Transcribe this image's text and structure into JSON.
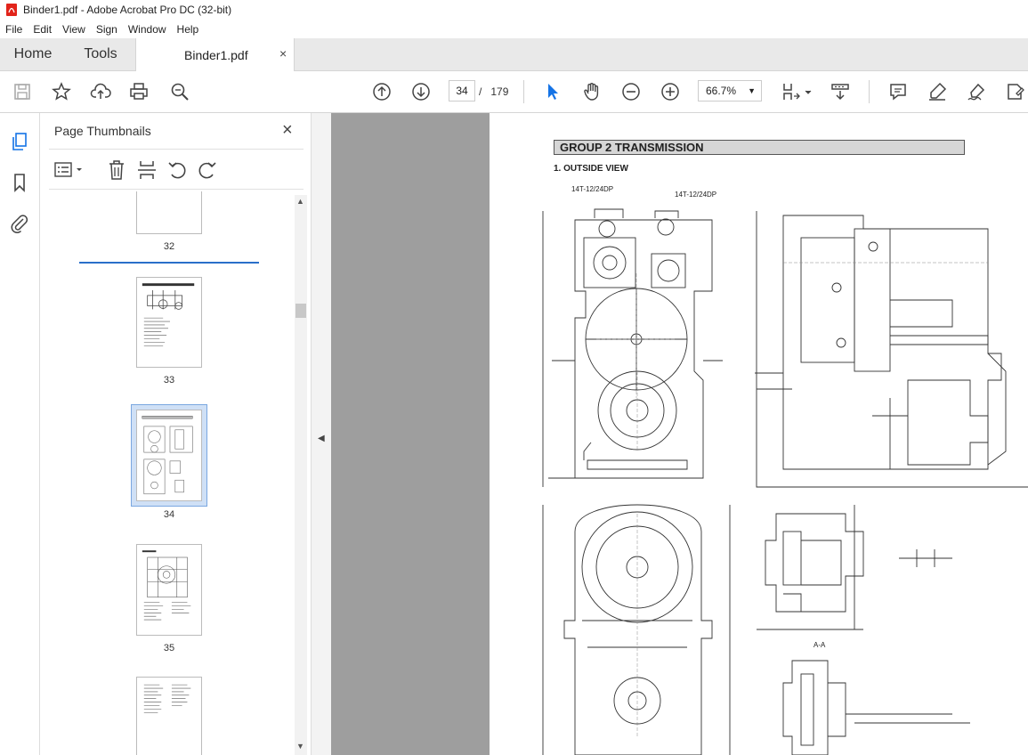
{
  "window": {
    "title": "Binder1.pdf - Adobe Acrobat Pro DC (32-bit)"
  },
  "menu": [
    "File",
    "Edit",
    "View",
    "Sign",
    "Window",
    "Help"
  ],
  "tabs": {
    "home": "Home",
    "tools": "Tools",
    "document": "Binder1.pdf",
    "close": "×"
  },
  "toolbar": {
    "icons": [
      "save-icon",
      "bookmark-star-icon",
      "upload-icon",
      "print-icon",
      "zoom-search-icon",
      "page-up-icon",
      "page-down-icon",
      "select-arrow-icon",
      "hand-icon",
      "zoom-out-icon",
      "zoom-in-icon",
      "fit-page-icon",
      "scroll-mode-icon",
      "comment-icon",
      "highlight-icon",
      "sign-icon",
      "fill-sign-icon"
    ],
    "current_page": "34",
    "page_separator": "/",
    "total_pages": "179",
    "zoom": "66.7%"
  },
  "panel": {
    "title": "Page Thumbnails",
    "close": "×",
    "thumbnails": [
      {
        "page": "32"
      },
      {
        "page": "33"
      },
      {
        "page": "34",
        "selected": true
      },
      {
        "page": "35"
      }
    ]
  },
  "document": {
    "group_title": "GROUP  2  TRANSMISSION",
    "section_title": "1. OUTSIDE VIEW",
    "drawing_labels": {
      "label_a": "14T-12/24DP",
      "label_b": "14T-12/24DP",
      "section_aa": "A-A"
    }
  }
}
